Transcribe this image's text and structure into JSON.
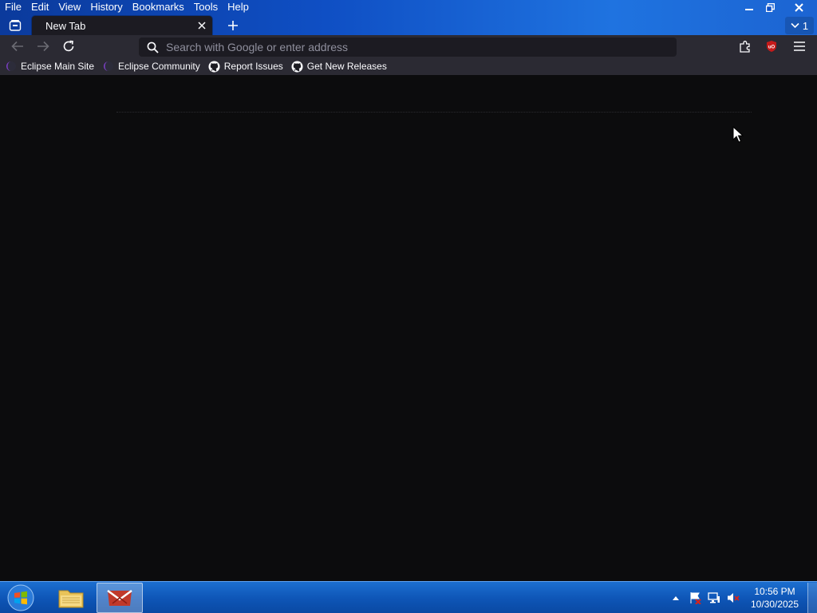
{
  "menu": [
    "File",
    "Edit",
    "View",
    "History",
    "Bookmarks",
    "Tools",
    "Help"
  ],
  "tab": {
    "title": "New Tab"
  },
  "tab_count": "1",
  "urlbar": {
    "placeholder": "Search with Google or enter address"
  },
  "bookmarks": [
    {
      "label": "Eclipse Main Site",
      "icon": "eclipse-icon"
    },
    {
      "label": "Eclipse Community",
      "icon": "eclipse-icon"
    },
    {
      "label": "Report Issues",
      "icon": "github-icon"
    },
    {
      "label": "Get New Releases",
      "icon": "github-icon"
    }
  ],
  "taskbar": {
    "apps": [
      {
        "name": "file-explorer",
        "icon": "folder-icon"
      },
      {
        "name": "browser",
        "icon": "browser-icon",
        "active": true
      }
    ]
  },
  "clock": {
    "time": "10:56 PM",
    "date": "10/30/2025"
  },
  "colors": {
    "titlebar": "#0f4fc4",
    "toolbar": "#2b2a33",
    "content_bg": "#0c0c0d",
    "ublock": "#c51a1a"
  }
}
